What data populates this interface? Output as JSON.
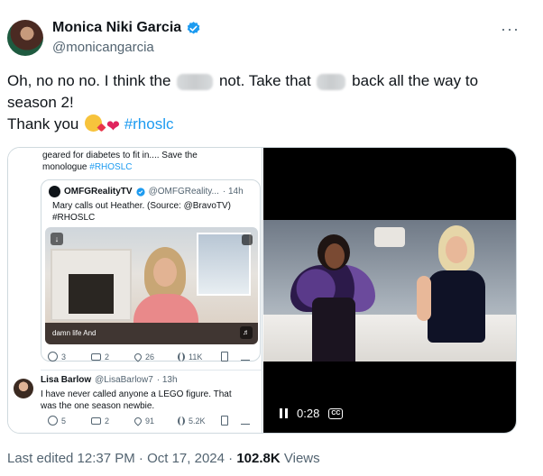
{
  "author": {
    "name": "Monica Niki Garcia",
    "handle": "@monicangarcia",
    "verified": true,
    "more_label": "···"
  },
  "tweet": {
    "line1_a": "Oh, no no no. I think the",
    "line1_b": "not. Take that",
    "line1_c": "back all the way to",
    "line2": "season 2!",
    "line3": "Thank you",
    "hashtag": "#rhoslc"
  },
  "media_left": {
    "top_text_1": "geared for  diabetes to fit in.... Save the",
    "top_text_2": "monologue",
    "top_hashtag": "#RHOSLC",
    "quote": {
      "name": "OMFGRealityTV",
      "handle": "@OMFGReality...",
      "time": "· 14h",
      "text": "Mary calls out Heather. (Source: @BravoTV) #RHOSLC",
      "caption": "damn life And"
    },
    "actions_1": [
      "3",
      "2",
      "26",
      "11K",
      ""
    ],
    "reply": {
      "name": "Lisa Barlow",
      "handle": "@LisaBarlow7",
      "time": "· 13h",
      "text": "I have never called anyone a LEGO figure. That was the one season newbie."
    },
    "actions_2": [
      "5",
      "2",
      "91",
      "5.2K",
      ""
    ]
  },
  "video": {
    "time": "0:28",
    "cc_label": "CC"
  },
  "meta": {
    "prefix": "Last edited 12:37 PM · Oct 17, 2024 ·",
    "views": "102.8K",
    "views_label": "Views"
  },
  "colors": {
    "link": "#1d9bf0",
    "muted": "#536471",
    "text": "#0f1419"
  }
}
